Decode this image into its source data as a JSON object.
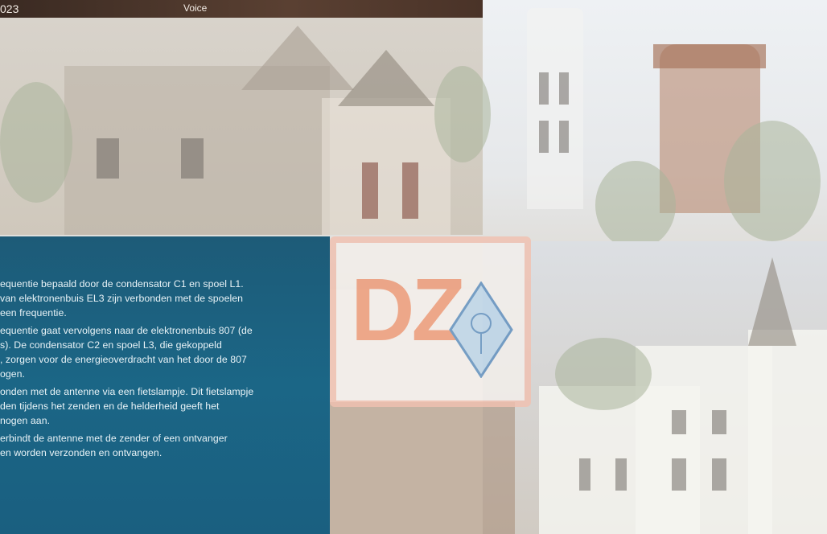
{
  "header": {
    "year_fragment": "023",
    "voice_label": "Voice"
  },
  "logo": {
    "letters": "DZ"
  },
  "info_panel": {
    "lines": [
      "equentie bepaald door de condensator C1 en spoel L1.",
      " van elektronenbuis EL3 zijn verbonden met de spoelen",
      " een frequentie.",
      "equentie gaat vervolgens naar de elektronenbuis 807 (de",
      "s). De condensator C2 en spoel L3, die gekoppeld",
      ", zorgen voor de energieoverdracht van het door de 807",
      "ogen.",
      "onden met de antenne via een fietslampje. Dit fietslampje",
      "den tijdens het zenden en de helderheid geeft het",
      "nogen aan.",
      "erbindt de antenne met de zender of een ontvanger",
      "en worden verzonden en ontvangen."
    ]
  },
  "colors": {
    "panel_blue": "#1b6686",
    "logo_orange": "#ef9a78",
    "logo_border": "#f1c1b1",
    "header_brown": "#4a3328"
  }
}
